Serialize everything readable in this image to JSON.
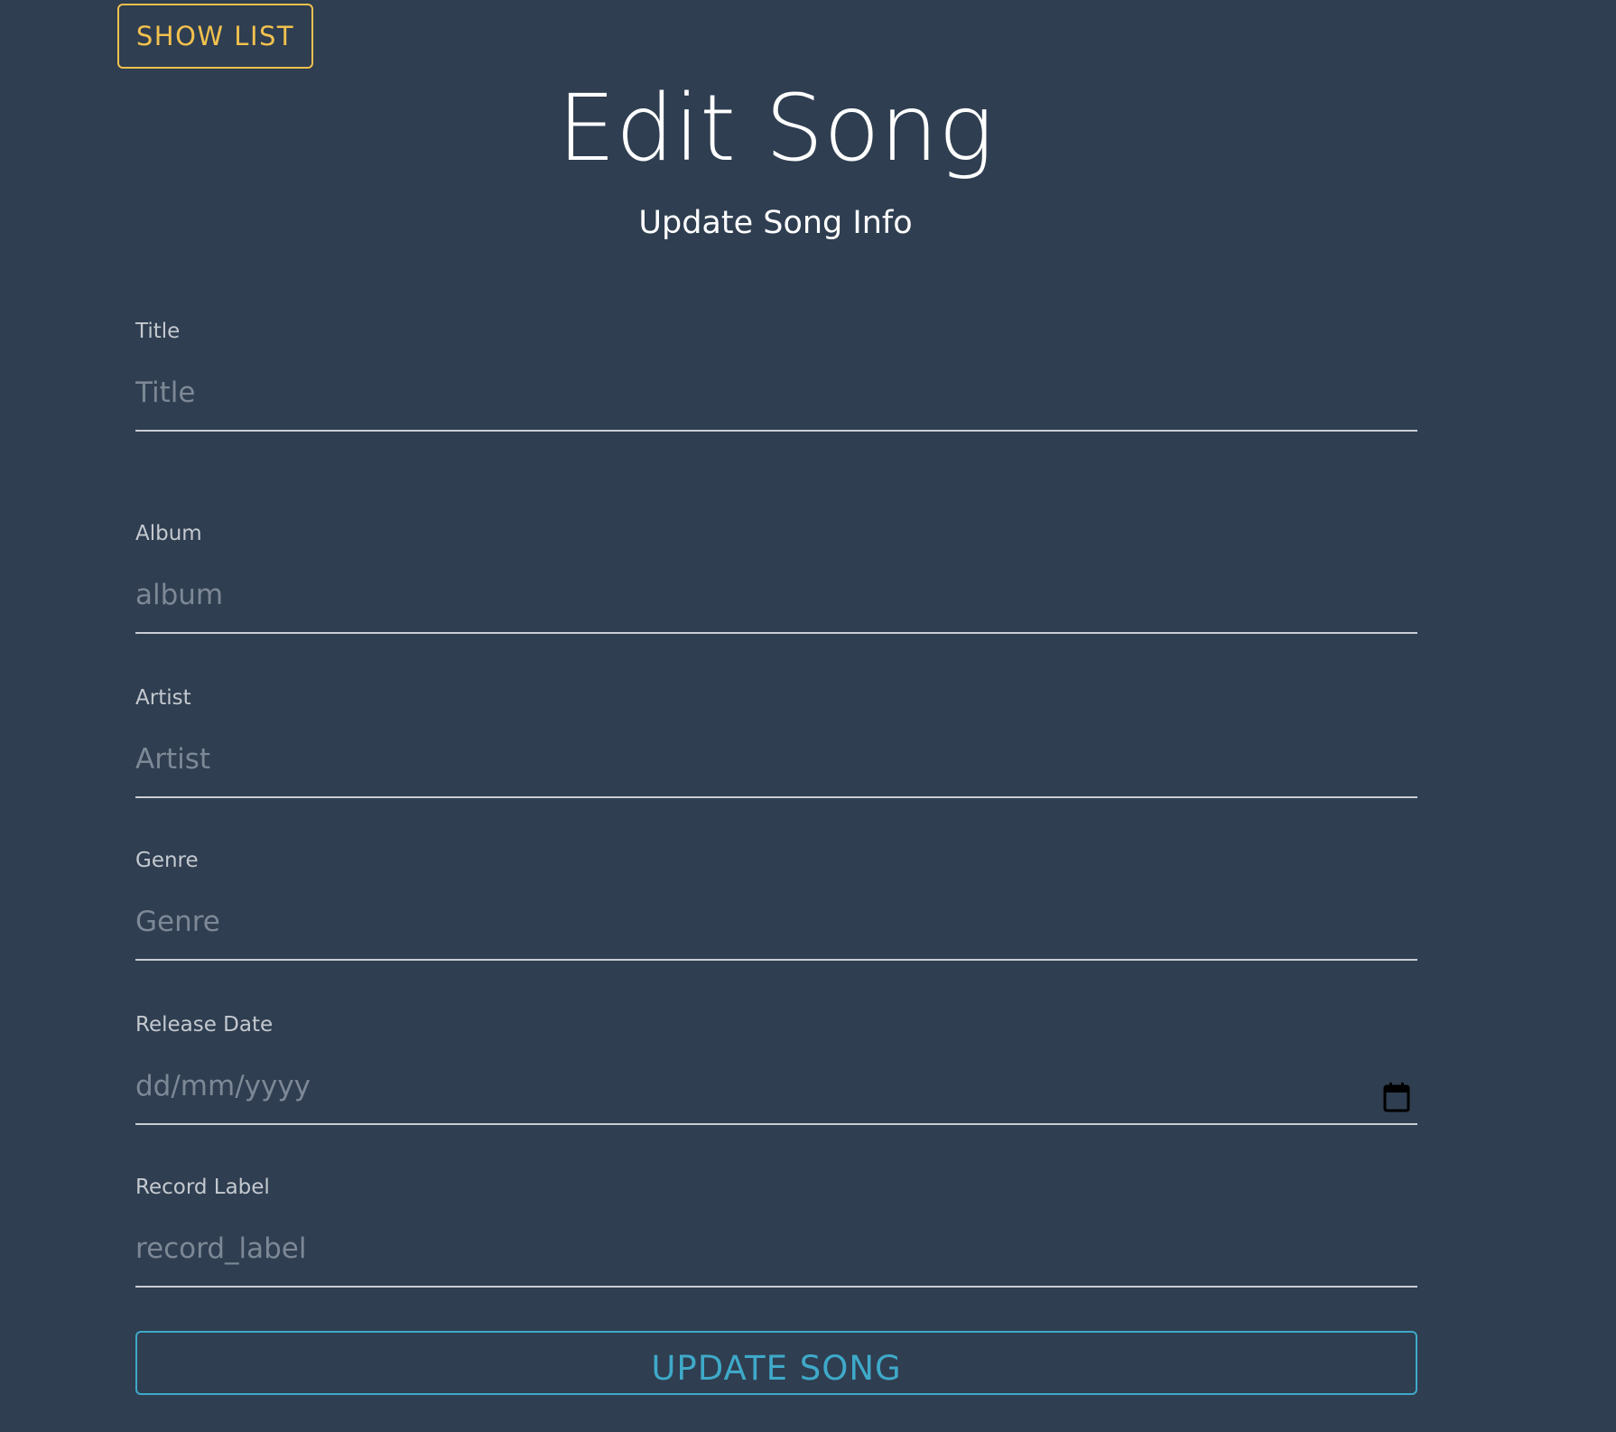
{
  "header": {
    "show_list_label": "SHOW LIST",
    "title": "Edit Song",
    "subtitle": "Update Song Info"
  },
  "form": {
    "fields": [
      {
        "label": "Title",
        "placeholder": "Title",
        "value": ""
      },
      {
        "label": "Album",
        "placeholder": "album",
        "value": ""
      },
      {
        "label": "Artist",
        "placeholder": "Artist",
        "value": ""
      },
      {
        "label": "Genre",
        "placeholder": "Genre",
        "value": ""
      },
      {
        "label": "Release Date",
        "placeholder": "dd/mm/yyyy",
        "value": "",
        "icon": "calendar-icon"
      },
      {
        "label": "Record Label",
        "placeholder": "record_label",
        "value": ""
      }
    ],
    "submit_label": "UPDATE SONG"
  },
  "colors": {
    "background": "#2f3e50",
    "show_list_accent": "#f2c14e",
    "update_accent": "#3fa9c9"
  }
}
